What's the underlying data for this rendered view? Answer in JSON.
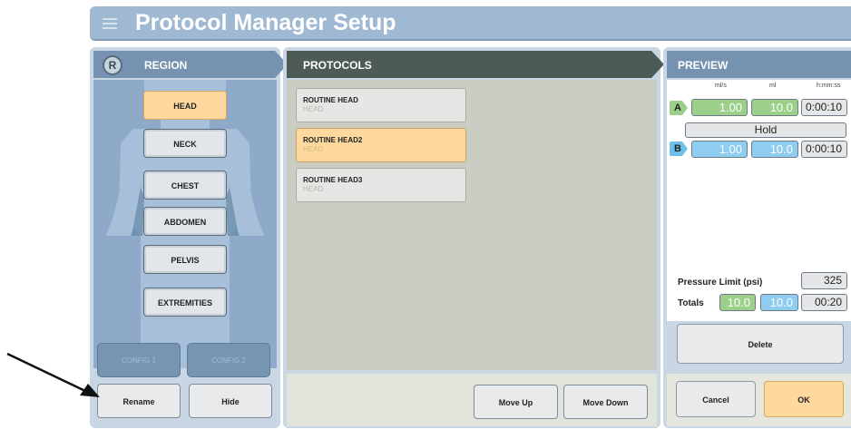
{
  "title": "Protocol Manager Setup",
  "region": {
    "header": "REGION",
    "badge": "R",
    "items": [
      {
        "label": "HEAD",
        "active": true
      },
      {
        "label": "NECK",
        "active": false
      },
      {
        "label": "CHEST",
        "active": false
      },
      {
        "label": "ABDOMEN",
        "active": false
      },
      {
        "label": "PELVIS",
        "active": false
      },
      {
        "label": "EXTREMITIES",
        "active": false
      }
    ],
    "config1": "CONFIG 1",
    "config2": "CONFIG 2",
    "rename": "Rename",
    "hide": "Hide"
  },
  "protocols": {
    "header": "PROTOCOLS",
    "items": [
      {
        "name": "ROUTINE HEAD",
        "region": "HEAD",
        "active": false
      },
      {
        "name": "ROUTINE HEAD2",
        "region": "HEAD",
        "active": true
      },
      {
        "name": "ROUTINE HEAD3",
        "region": "HEAD",
        "active": false
      }
    ],
    "move_up": "Move Up",
    "move_down": "Move Down"
  },
  "preview": {
    "header": "PREVIEW",
    "units": {
      "rate": "ml/s",
      "volume": "ml",
      "time": "h:mm:ss"
    },
    "phases": [
      {
        "tag": "A",
        "rate": "1.00",
        "volume": "10.0",
        "time": "0:00:10"
      },
      {
        "tag": "B",
        "rate": "1.00",
        "volume": "10.0",
        "time": "0:00:10"
      }
    ],
    "hold": "Hold",
    "pressure_label": "Pressure Limit (psi)",
    "pressure_value": "325",
    "totals_label": "Totals",
    "totals": {
      "a": "10.0",
      "b": "10.0",
      "time": "00:20"
    },
    "delete": "Delete",
    "cancel": "Cancel",
    "ok": "OK"
  },
  "colors": {
    "accent": "#fdd9a0",
    "header_blue": "#7592b0",
    "header_dark": "#4d5a56",
    "fluid_a": "#9cd08a",
    "fluid_b": "#8fcdf0"
  }
}
